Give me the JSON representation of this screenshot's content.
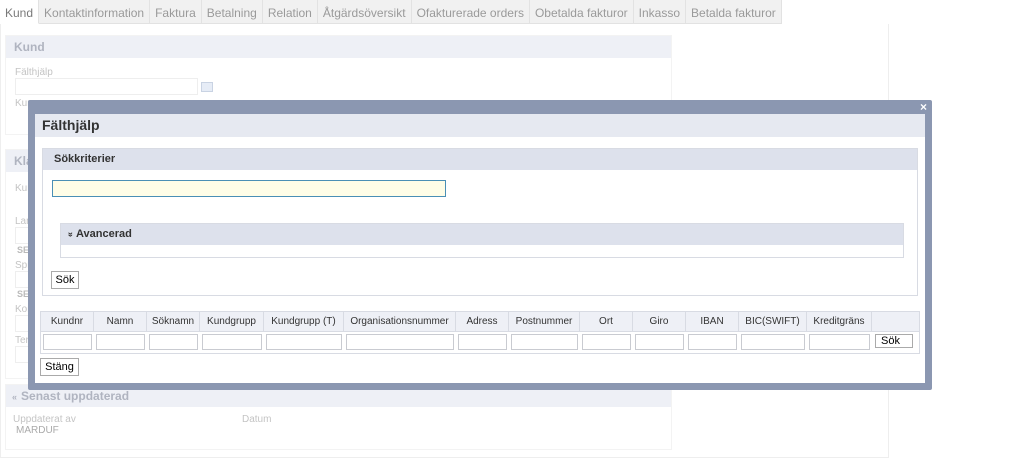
{
  "tabs": [
    "Kund",
    "Kontaktinformation",
    "Faktura",
    "Betalning",
    "Relation",
    "Åtgärdsöversikt",
    "Ofakturerade orders",
    "Obetalda fakturor",
    "Inkasso",
    "Betalda fakturor"
  ],
  "background": {
    "kund_title": "Kund",
    "falthjalp_label": "Fälthjälp",
    "kund_label_truncated": "Kun",
    "kla_title_truncated": "Kla",
    "kun_label_2": "Kun",
    "lan_label": "Lan",
    "se_1": "SE",
    "spr_label": "Spr",
    "se_2": "SE",
    "kon_label": "Kon",
    "ter_label": "Ter",
    "senast_title": "Senast uppdaterad",
    "uppdaterat_av_label": "Uppdaterat av",
    "uppdaterat_av_value": "MARDUF",
    "datum_label": "Datum"
  },
  "modal": {
    "title": "Fälthjälp",
    "close_icon": "×",
    "criteria_title": "Sökkriterier",
    "search_value": "",
    "advanced_icon": "»",
    "advanced_label": "Avancerad",
    "search_button": "Sök",
    "close_button": "Stäng",
    "filter_search_button": "Sök",
    "columns": [
      "Kundnr",
      "Namn",
      "Söknamn",
      "Kundgrupp",
      "Kundgrupp (T)",
      "Organisationsnummer",
      "Adress",
      "Postnummer",
      "Ort",
      "Giro",
      "IBAN",
      "BIC(SWIFT)",
      "Kreditgräns"
    ]
  }
}
